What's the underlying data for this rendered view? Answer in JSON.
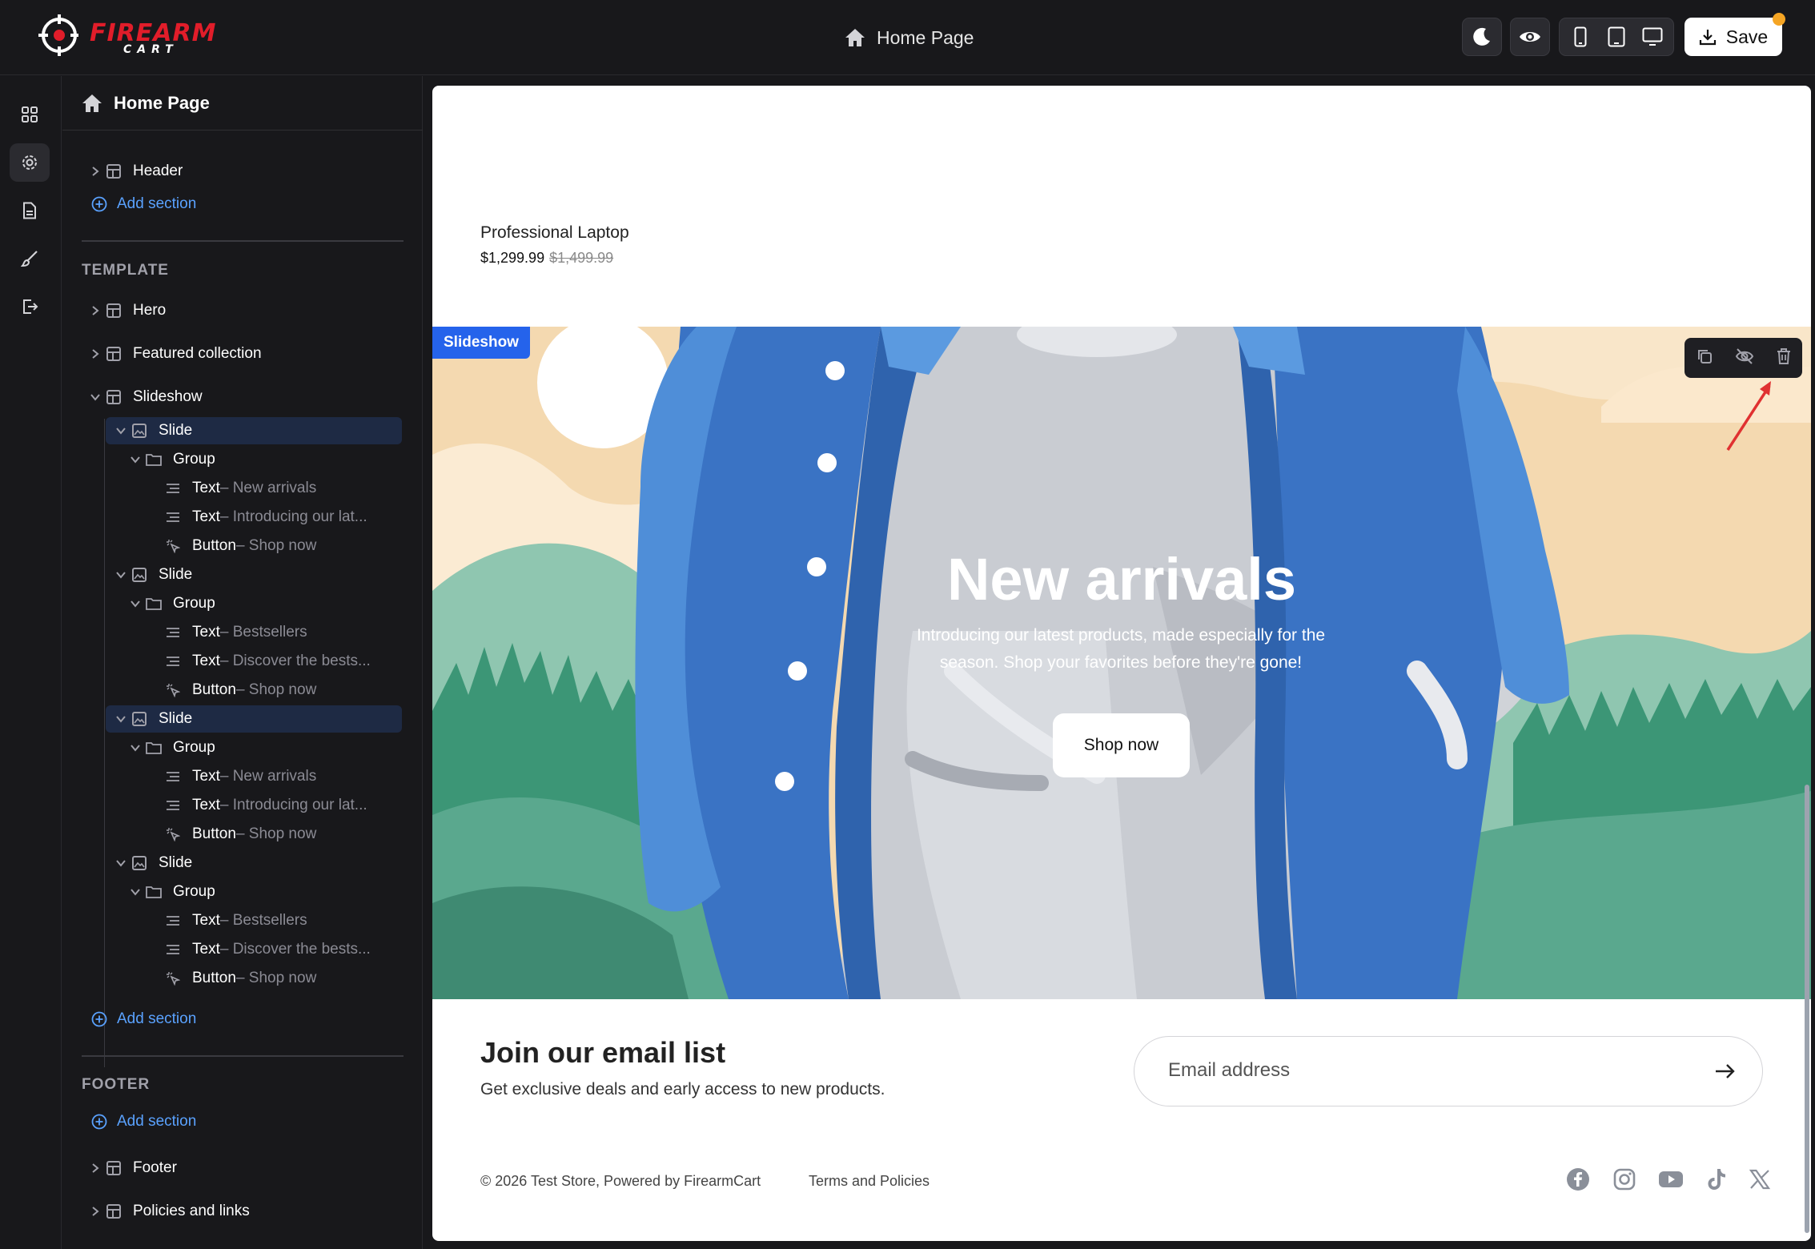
{
  "topbar": {
    "logo_text": "FIREARM",
    "logo_sub": "CART",
    "page_title": "Home Page",
    "save_label": "Save"
  },
  "sidebar": {
    "title": "Home Page",
    "header_item": "Header",
    "add_section": "Add section",
    "template_label": "TEMPLATE",
    "footer_label": "FOOTER",
    "items": {
      "hero": "Hero",
      "featured": "Featured collection",
      "slideshow": "Slideshow",
      "slide": "Slide",
      "group": "Group",
      "text": "Text",
      "button": "Button",
      "footer": "Footer",
      "policies": "Policies and links"
    },
    "slides": [
      {
        "text1": " – New arrivals",
        "text2": " – Introducing our lat...",
        "button": " – Shop now"
      },
      {
        "text1": " – Bestsellers",
        "text2": " – Discover the bests...",
        "button": " – Shop now"
      },
      {
        "text1": " – New arrivals",
        "text2": " – Introducing our lat...",
        "button": " – Shop now"
      },
      {
        "text1": " – Bestsellers",
        "text2": " – Discover the bests...",
        "button": " – Shop now"
      }
    ]
  },
  "canvas": {
    "product_name": "Professional Laptop",
    "price": "$1,299.99",
    "old_price": "$1,499.99",
    "slideshow_tag": "Slideshow",
    "hero_title": "New arrivals",
    "hero_sub": "Introducing our latest products, made especially for the season. Shop your favorites before they're gone!",
    "hero_button": "Shop now",
    "email_title": "Join our email list",
    "email_sub": "Get exclusive deals and early access to new products.",
    "email_placeholder": "Email address",
    "copyright": "© 2026 Test Store, Powered by FirearmCart",
    "terms": "Terms and Policies"
  },
  "colors": {
    "accent": "#2563eb",
    "link": "#5aa2ff",
    "save_dot": "#f5a524",
    "sidebar_bg": "#18181b",
    "highlight": "#1e2a44"
  },
  "icons": {
    "rail": [
      "grid-icon",
      "gear-icon",
      "document-icon",
      "brush-icon",
      "exit-icon"
    ],
    "toolbar": [
      "duplicate-icon",
      "hide-icon",
      "trash-icon"
    ],
    "socials": [
      "facebook-icon",
      "instagram-icon",
      "youtube-icon",
      "tiktok-icon",
      "x-icon"
    ]
  }
}
